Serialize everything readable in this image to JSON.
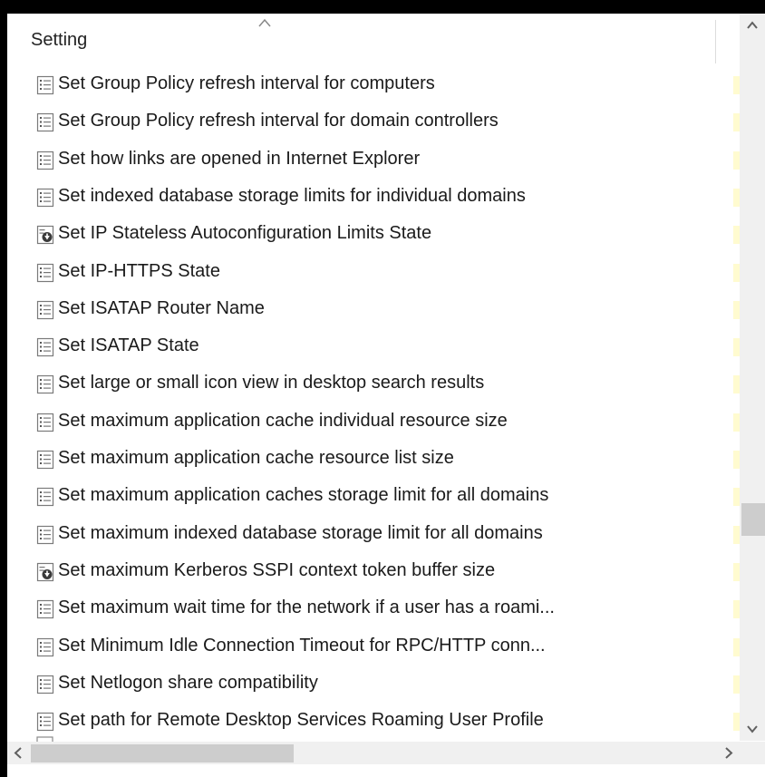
{
  "header": {
    "column_title": "Setting"
  },
  "rows": [
    {
      "label": "Set Group Policy refresh interval for computers",
      "icon": "policy-list-icon"
    },
    {
      "label": "Set Group Policy refresh interval for domain controllers",
      "icon": "policy-list-icon"
    },
    {
      "label": "Set how links are opened in Internet Explorer",
      "icon": "policy-list-icon"
    },
    {
      "label": "Set indexed database storage limits for individual domains",
      "icon": "policy-list-icon"
    },
    {
      "label": "Set IP Stateless Autoconfiguration Limits State",
      "icon": "policy-download-icon"
    },
    {
      "label": "Set IP-HTTPS State",
      "icon": "policy-list-icon"
    },
    {
      "label": "Set ISATAP Router Name",
      "icon": "policy-list-icon"
    },
    {
      "label": "Set ISATAP State",
      "icon": "policy-list-icon"
    },
    {
      "label": "Set large or small icon view in desktop search results",
      "icon": "policy-list-icon"
    },
    {
      "label": "Set maximum application cache individual resource size",
      "icon": "policy-list-icon"
    },
    {
      "label": "Set maximum application cache resource list size",
      "icon": "policy-list-icon"
    },
    {
      "label": "Set maximum application caches storage limit for all domains",
      "icon": "policy-list-icon"
    },
    {
      "label": "Set maximum indexed database storage limit for all domains",
      "icon": "policy-list-icon"
    },
    {
      "label": "Set maximum Kerberos SSPI context token buffer size",
      "icon": "policy-download-icon"
    },
    {
      "label": "Set maximum wait time for the network if a user has a roami...",
      "icon": "policy-list-icon"
    },
    {
      "label": "Set Minimum Idle Connection Timeout for RPC/HTTP conn...",
      "icon": "policy-list-icon"
    },
    {
      "label": "Set Netlogon share compatibility",
      "icon": "policy-list-icon"
    },
    {
      "label": "Set path for Remote Desktop Services Roaming User Profile",
      "icon": "policy-list-icon"
    }
  ],
  "scrollbars": {
    "vertical_position": 0.72,
    "horizontal_position": 0.0
  },
  "colors": {
    "highlight_tick": "#fffbd0",
    "scrollbar_track": "#f0f0f0",
    "scrollbar_thumb": "#cdcdcd"
  }
}
